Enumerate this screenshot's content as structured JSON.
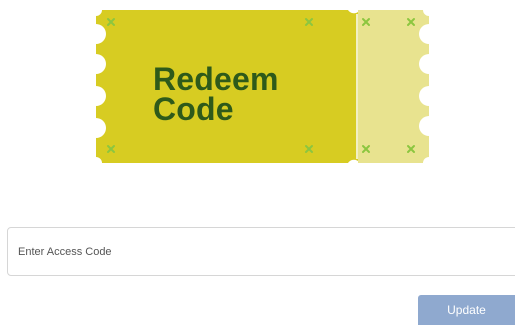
{
  "ticket": {
    "title_line1": "Redeem",
    "title_line2": "Code",
    "icon": "ticket-icon",
    "main_color": "#d7cc22",
    "stub_color": "#e8e38f",
    "text_color": "#2e5a1a",
    "mark_color": "#8cc63f"
  },
  "form": {
    "access_code_placeholder": "Enter Access Code",
    "access_code_value": "",
    "update_label": "Update",
    "button_color": "#8fa9cf"
  }
}
